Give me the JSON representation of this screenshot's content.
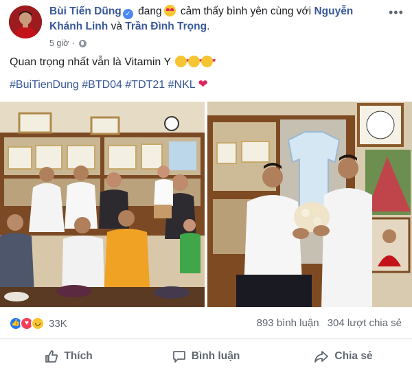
{
  "post": {
    "author": "Bùi Tiến Dũng",
    "verified_icon": "verified-badge",
    "feeling_prefix": "đang",
    "feeling_emoji": "heart-eyes-emoji",
    "feeling_text": "cảm thấy bình yên cùng với",
    "tagged_1": "Nguyễn Khánh Linh",
    "joiner": "và",
    "tagged_2": "Trần Đình Trọng",
    "period": ".",
    "time": "5 giờ",
    "dot": "·",
    "privacy_icon": "globe-icon",
    "more_label": "•••",
    "caption": "Quan trọng nhất vẫn là Vitamin Y",
    "caption_emojis": [
      "smiling-face-with-hearts",
      "smiling-face-with-hearts",
      "smiling-face-with-hearts"
    ],
    "hashtags": "#BuiTienDung #BTD04 #TDT21 #NKL",
    "hashtag_heart": "❤"
  },
  "reactions": {
    "icons": [
      "like",
      "love",
      "haha"
    ],
    "count": "33K",
    "comments": "893 bình luận",
    "shares": "304 lượt chia sẻ"
  },
  "actions": {
    "like": "Thích",
    "comment": "Bình luận",
    "share": "Chia sẻ"
  },
  "colors": {
    "link_blue": "#385898",
    "muted": "#606770",
    "like_blue": "#2078f4",
    "love_red": "#f33e58",
    "haha_yellow": "#f7c531"
  }
}
